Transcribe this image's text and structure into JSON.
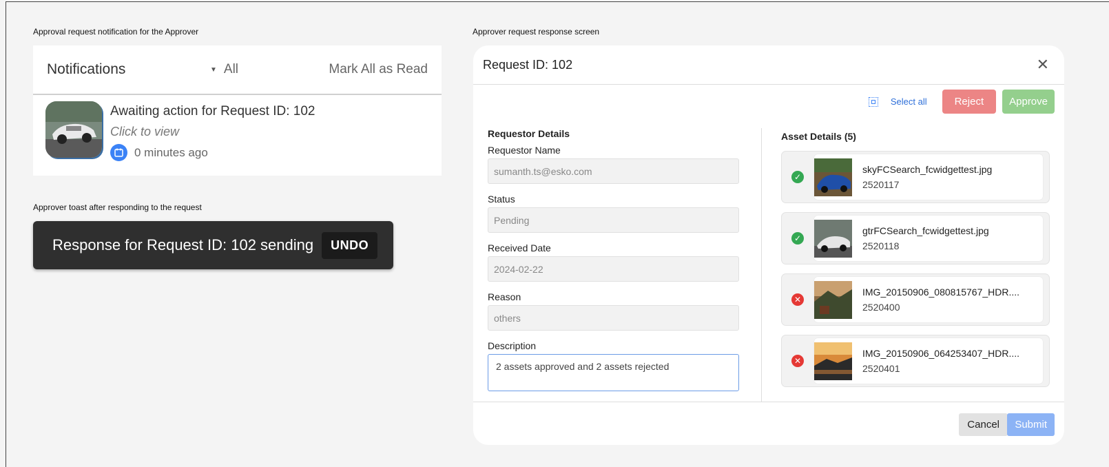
{
  "captions": {
    "notification": "Approval request notification for the Approver",
    "toast": "Approver toast after responding to the request",
    "response": "Approver request response screen"
  },
  "notifications": {
    "title": "Notifications",
    "filter": "All",
    "mark_all": "Mark All as Read",
    "item": {
      "message": "Awaiting action for Request ID: 102",
      "sub": "Click to view",
      "time": "0 minutes ago",
      "icon": "calendar-icon"
    }
  },
  "toast": {
    "message": "Response for Request ID: 102 sending",
    "undo": "UNDO"
  },
  "modal": {
    "title": "Request ID: 102",
    "select_all": "Select all",
    "reject": "Reject",
    "approve": "Approve",
    "requestor_section": "Requestor Details",
    "fields": {
      "name_label": "Requestor Name",
      "name_value": "sumanth.ts@esko.com",
      "status_label": "Status",
      "status_value": "Pending",
      "date_label": "Received Date",
      "date_value": "2024-02-22",
      "reason_label": "Reason",
      "reason_value": "others",
      "desc_label": "Description",
      "desc_value": "2 assets approved and 2 assets rejected"
    },
    "asset_section": "Asset Details (5)",
    "assets": [
      {
        "name": "skyFCSearch_fcwidgettest.jpg",
        "id": "2520117",
        "status": "approved"
      },
      {
        "name": "gtrFCSearch_fcwidgettest.jpg",
        "id": "2520118",
        "status": "approved"
      },
      {
        "name": "IMG_20150906_080815767_HDR....",
        "id": "2520400",
        "status": "rejected"
      },
      {
        "name": "IMG_20150906_064253407_HDR....",
        "id": "2520401",
        "status": "rejected"
      }
    ],
    "cancel": "Cancel",
    "submit": "Submit"
  },
  "colors": {
    "accent": "#3b82f6",
    "reject": "#ec8585",
    "approve": "#94cf8d",
    "ok": "#34a853",
    "bad": "#e53935"
  }
}
